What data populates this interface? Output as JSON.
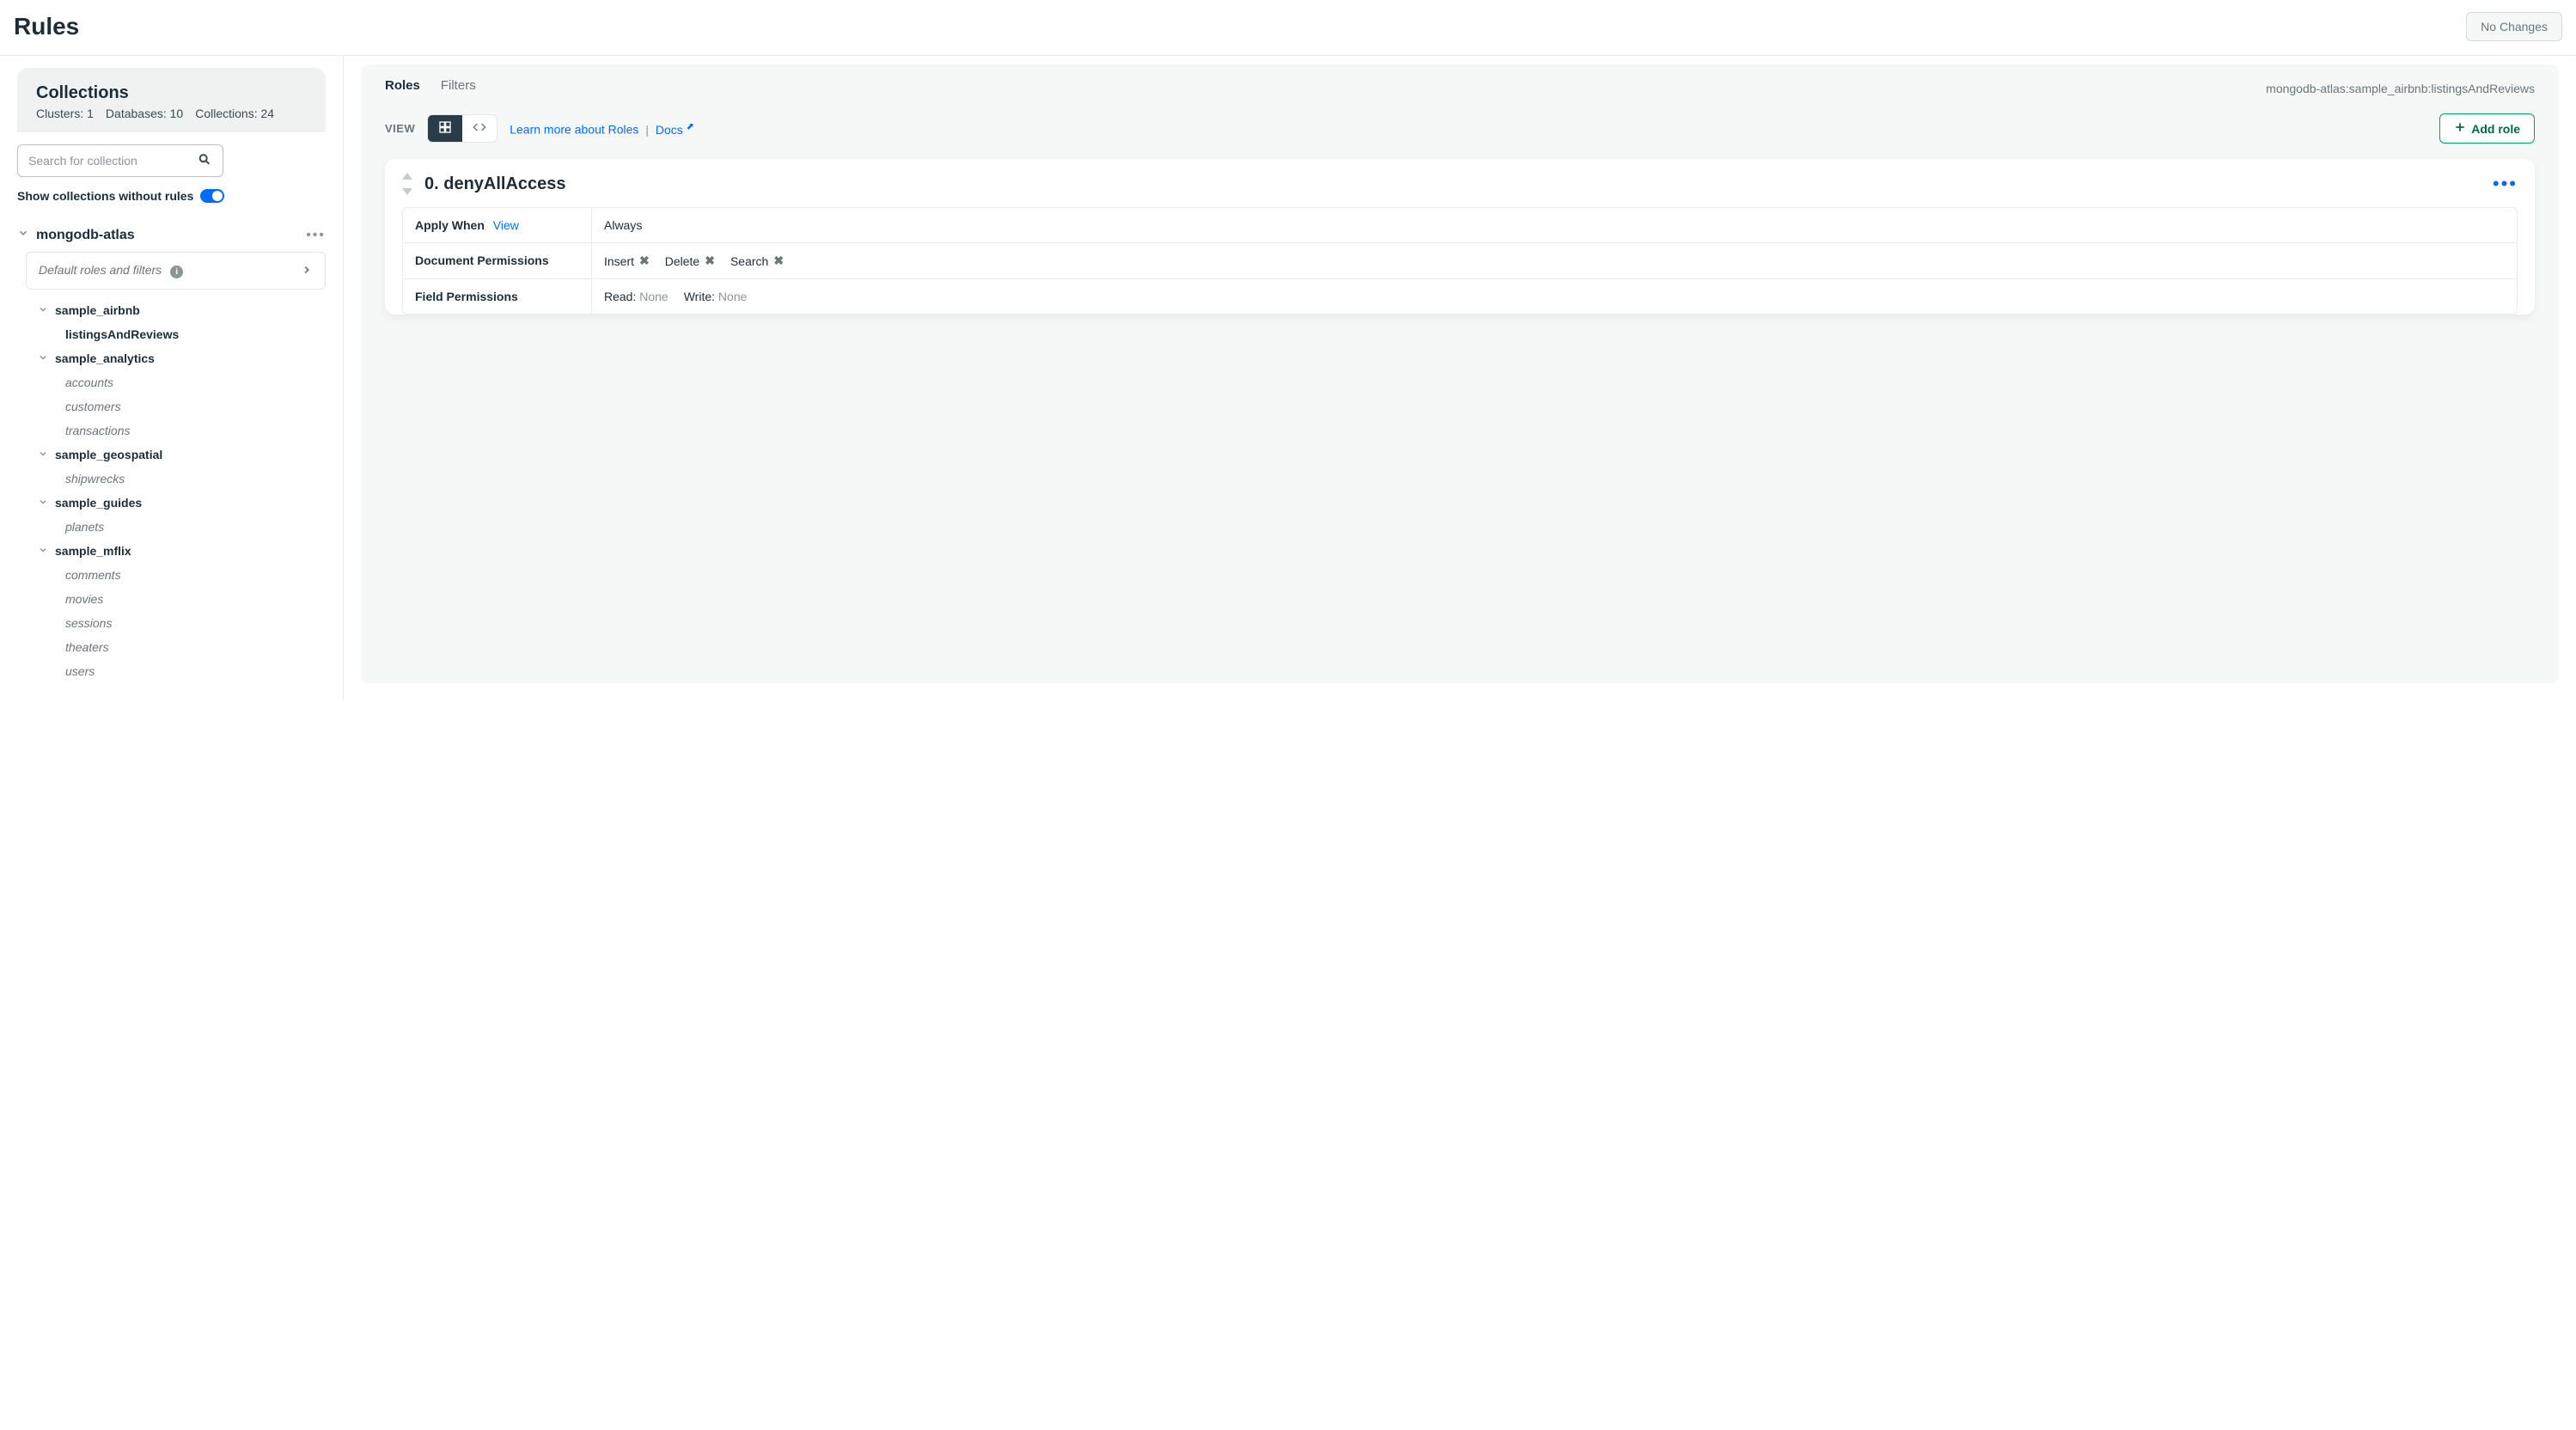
{
  "header": {
    "title": "Rules",
    "no_changes": "No Changes"
  },
  "sidebar": {
    "collections_title": "Collections",
    "clusters_label": "Clusters:",
    "clusters_value": "1",
    "databases_label": "Databases:",
    "databases_value": "10",
    "collections_label": "Collections:",
    "collections_value": "24",
    "search_placeholder": "Search for collection",
    "show_without_rules": "Show collections without rules",
    "cluster_name": "mongodb-atlas",
    "default_roles": "Default roles and filters",
    "databases": [
      {
        "name": "sample_airbnb",
        "collections": [
          {
            "name": "listingsAndReviews",
            "active": true
          }
        ]
      },
      {
        "name": "sample_analytics",
        "collections": [
          {
            "name": "accounts"
          },
          {
            "name": "customers"
          },
          {
            "name": "transactions"
          }
        ]
      },
      {
        "name": "sample_geospatial",
        "collections": [
          {
            "name": "shipwrecks"
          }
        ]
      },
      {
        "name": "sample_guides",
        "collections": [
          {
            "name": "planets"
          }
        ]
      },
      {
        "name": "sample_mflix",
        "collections": [
          {
            "name": "comments"
          },
          {
            "name": "movies"
          },
          {
            "name": "sessions"
          },
          {
            "name": "theaters"
          },
          {
            "name": "users"
          }
        ]
      }
    ]
  },
  "main": {
    "tabs": {
      "roles": "Roles",
      "filters": "Filters"
    },
    "breadcrumb": "mongodb-atlas:sample_airbnb:listingsAndReviews",
    "view_label": "VIEW",
    "learn_more": "Learn more about Roles",
    "docs": "Docs",
    "add_role": "Add role",
    "role": {
      "title": "0. denyAllAccess",
      "apply_when_label": "Apply When",
      "apply_when_view": "View",
      "apply_when_value": "Always",
      "doc_perms_label": "Document Permissions",
      "doc_perms": {
        "insert": "Insert",
        "delete": "Delete",
        "search": "Search"
      },
      "field_perms_label": "Field Permissions",
      "field_perms": {
        "read_label": "Read:",
        "read_value": "None",
        "write_label": "Write:",
        "write_value": "None"
      }
    }
  }
}
